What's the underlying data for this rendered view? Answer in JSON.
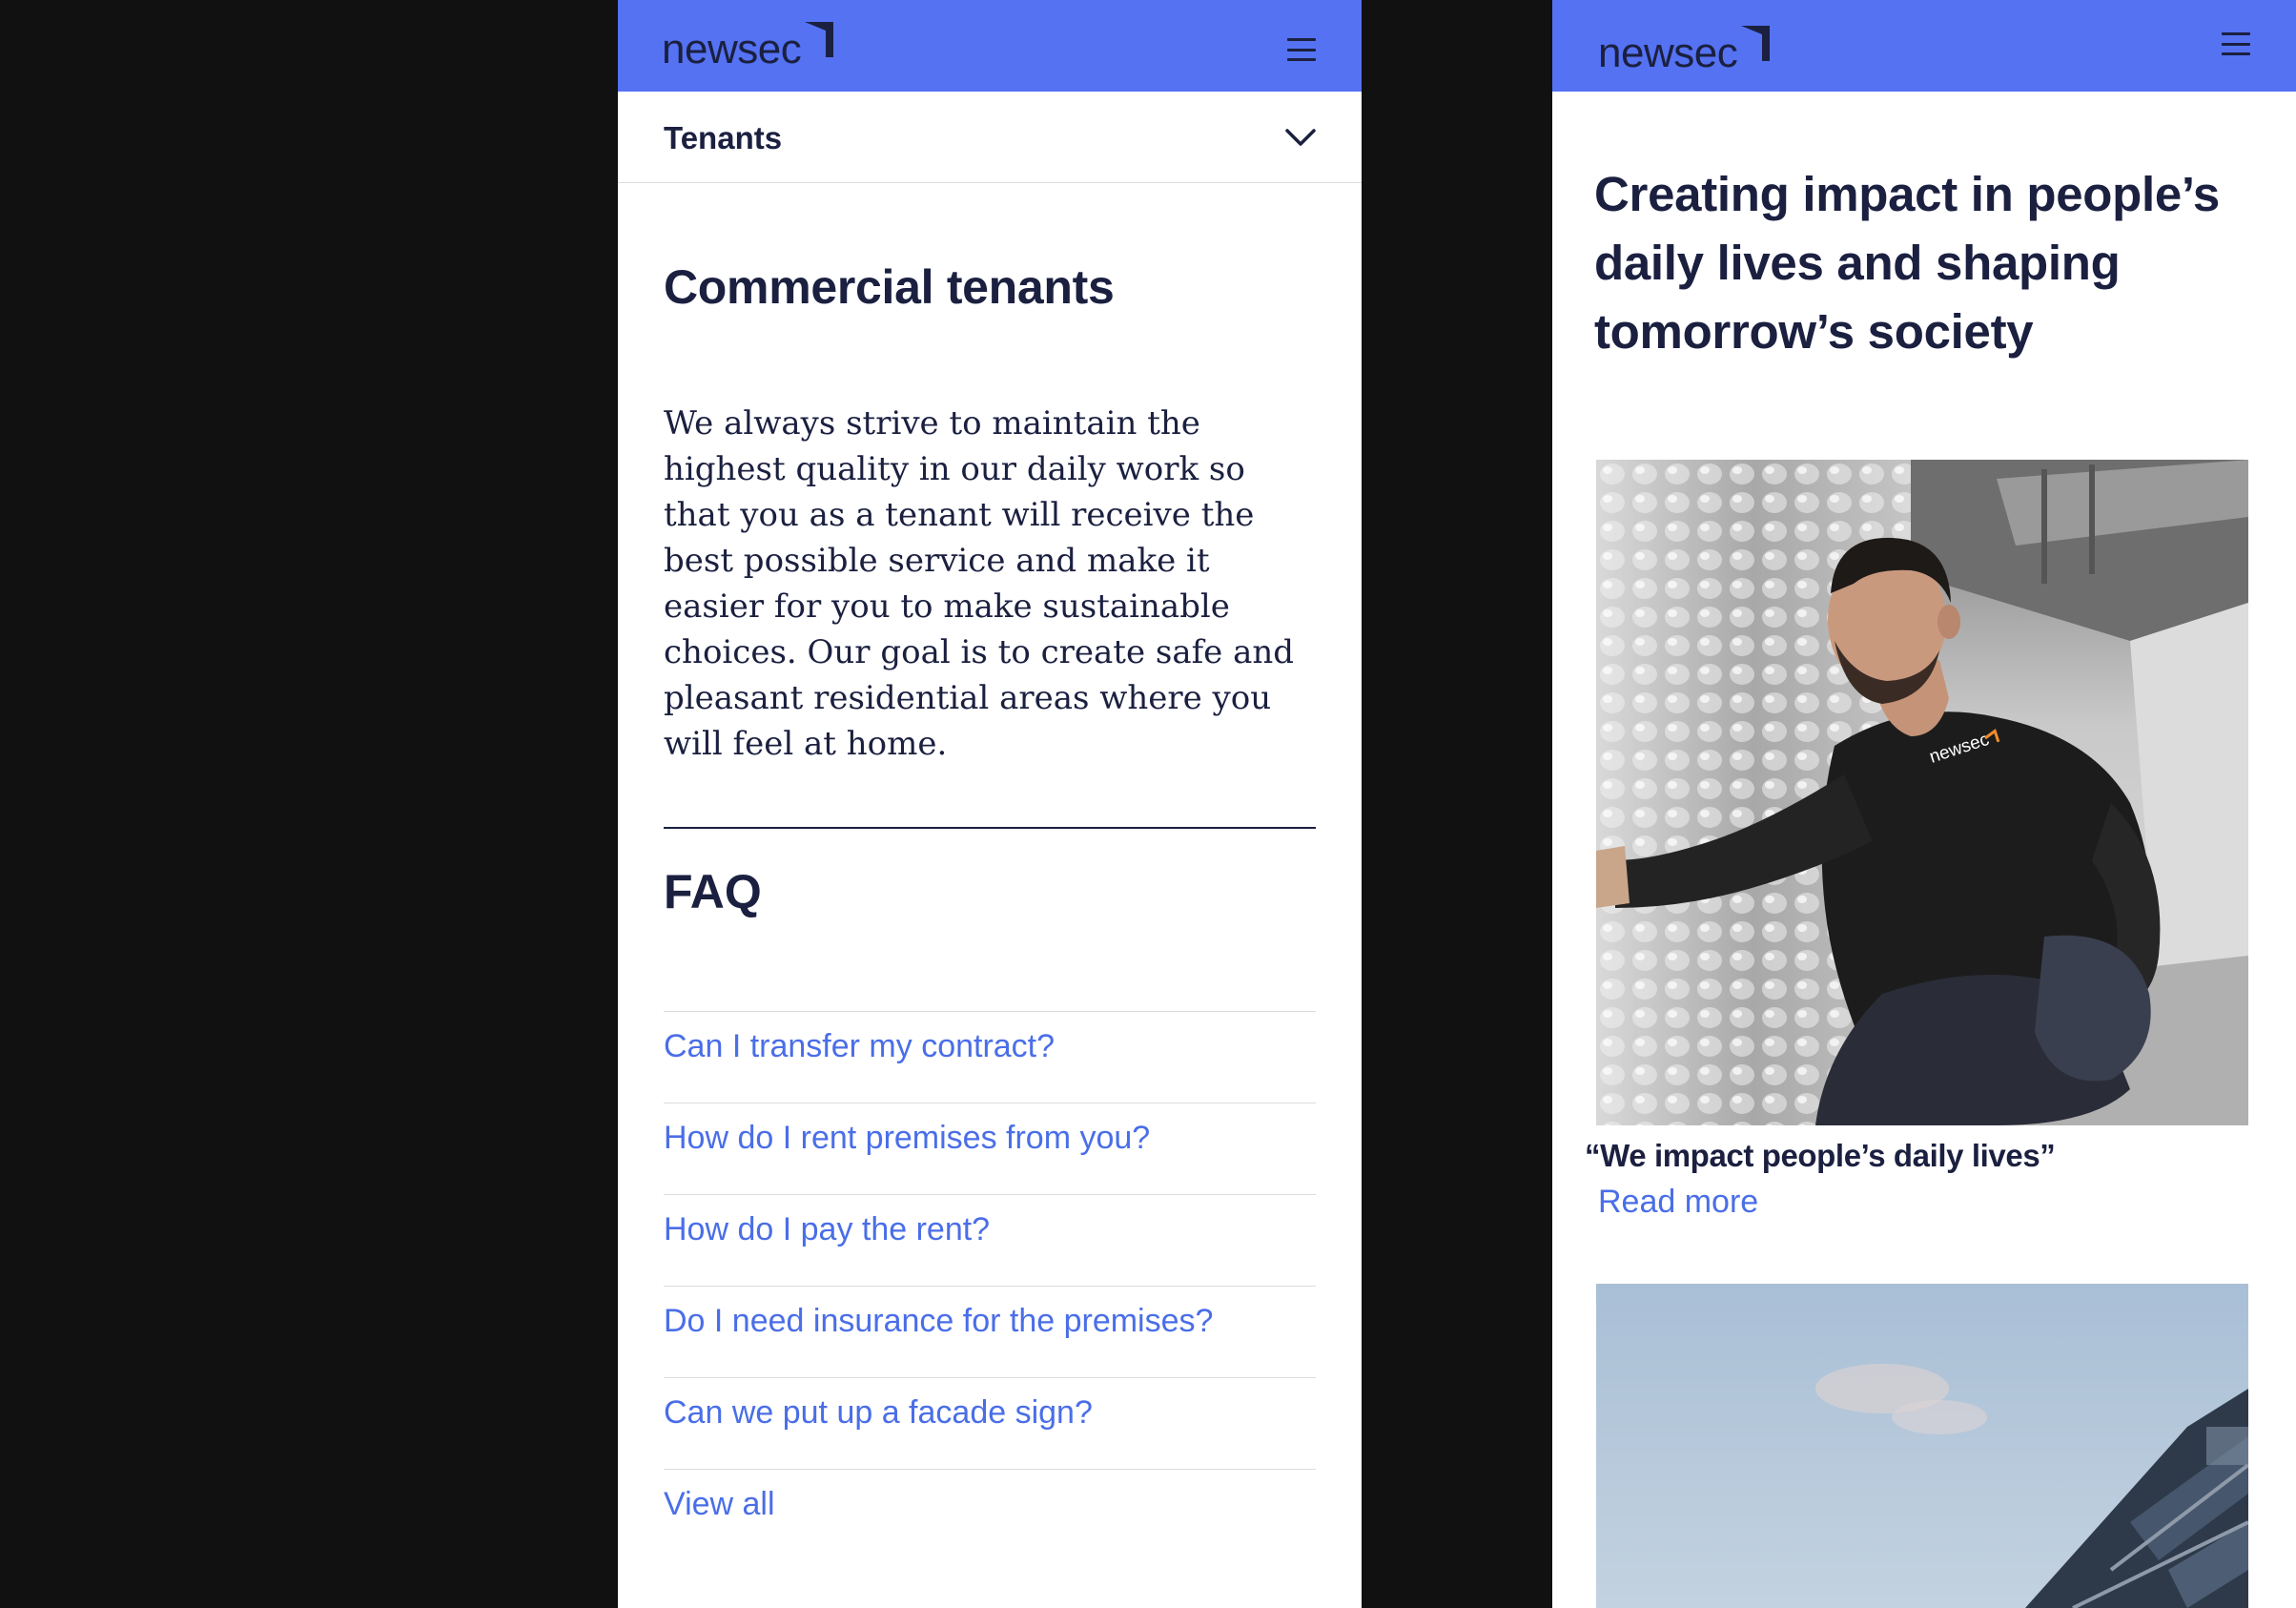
{
  "brand": {
    "name": "newsec",
    "header_color": "#5472f2",
    "text_color": "#1b2040",
    "link_color": "#4a6ee8"
  },
  "left": {
    "subnav": {
      "label": "Tenants",
      "icon": "chevron-down-icon"
    },
    "heading": "Commercial tenants",
    "intro": "We always strive to maintain the highest quality in our daily work so that you as a tenant will receive the best possible service and make it easier for you to make sustainable choices. Our goal is to create safe and pleasant residential areas where you will feel at home.",
    "faq": {
      "title": "FAQ",
      "items": [
        "Can I transfer my contract?",
        "How do I rent premises from you?",
        "How do I pay the rent?",
        "Do I need insurance for the premises?",
        "Can we put up a facade sign?",
        "View all"
      ]
    }
  },
  "right": {
    "hero_title": "Creating impact in people’s daily lives and shaping tomorrow’s society",
    "story": {
      "quote": "“We impact people’s daily lives”",
      "link": "Read more",
      "photo_badge": "newsec"
    }
  }
}
